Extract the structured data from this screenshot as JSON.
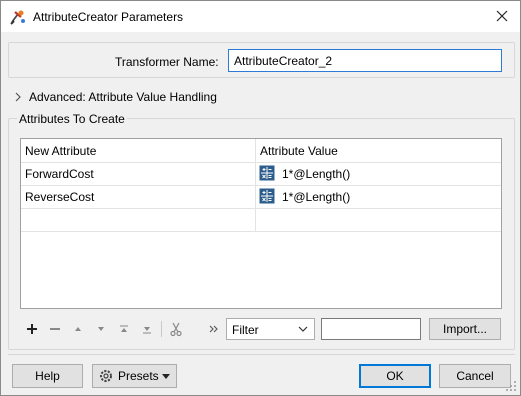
{
  "window": {
    "title": "AttributeCreator Parameters",
    "icon": "attributecreator-icon",
    "close_icon": "close-icon"
  },
  "transformer": {
    "name_label": "Transformer Name:",
    "name_value": "AttributeCreator_2"
  },
  "advanced": {
    "label": "Advanced: Attribute Value Handling",
    "icon": "chevron-right-icon"
  },
  "attributes": {
    "group_title": "Attributes To Create",
    "columns": [
      "New Attribute",
      "Attribute Value"
    ],
    "rows": [
      {
        "name": "ForwardCost",
        "value": "1*@Length()",
        "icon": "arithmetic-icon"
      },
      {
        "name": "ReverseCost",
        "value": "1*@Length()",
        "icon": "arithmetic-icon"
      }
    ]
  },
  "toolbar": {
    "icons": [
      "add-icon",
      "remove-icon",
      "move-up-icon",
      "move-down-icon",
      "move-top-icon",
      "move-bottom-icon",
      "cut-icon",
      "more-icon"
    ],
    "filter_selected": "Filter",
    "filter_input_value": "",
    "import_label": "Import..."
  },
  "buttons": {
    "help": "Help",
    "presets": "Presets",
    "ok": "OK",
    "cancel": "Cancel"
  },
  "colors": {
    "focus_border": "#2d7bd6",
    "default_button_border": "#0078d7",
    "arithmetic_icon": "#2c5d8c"
  }
}
